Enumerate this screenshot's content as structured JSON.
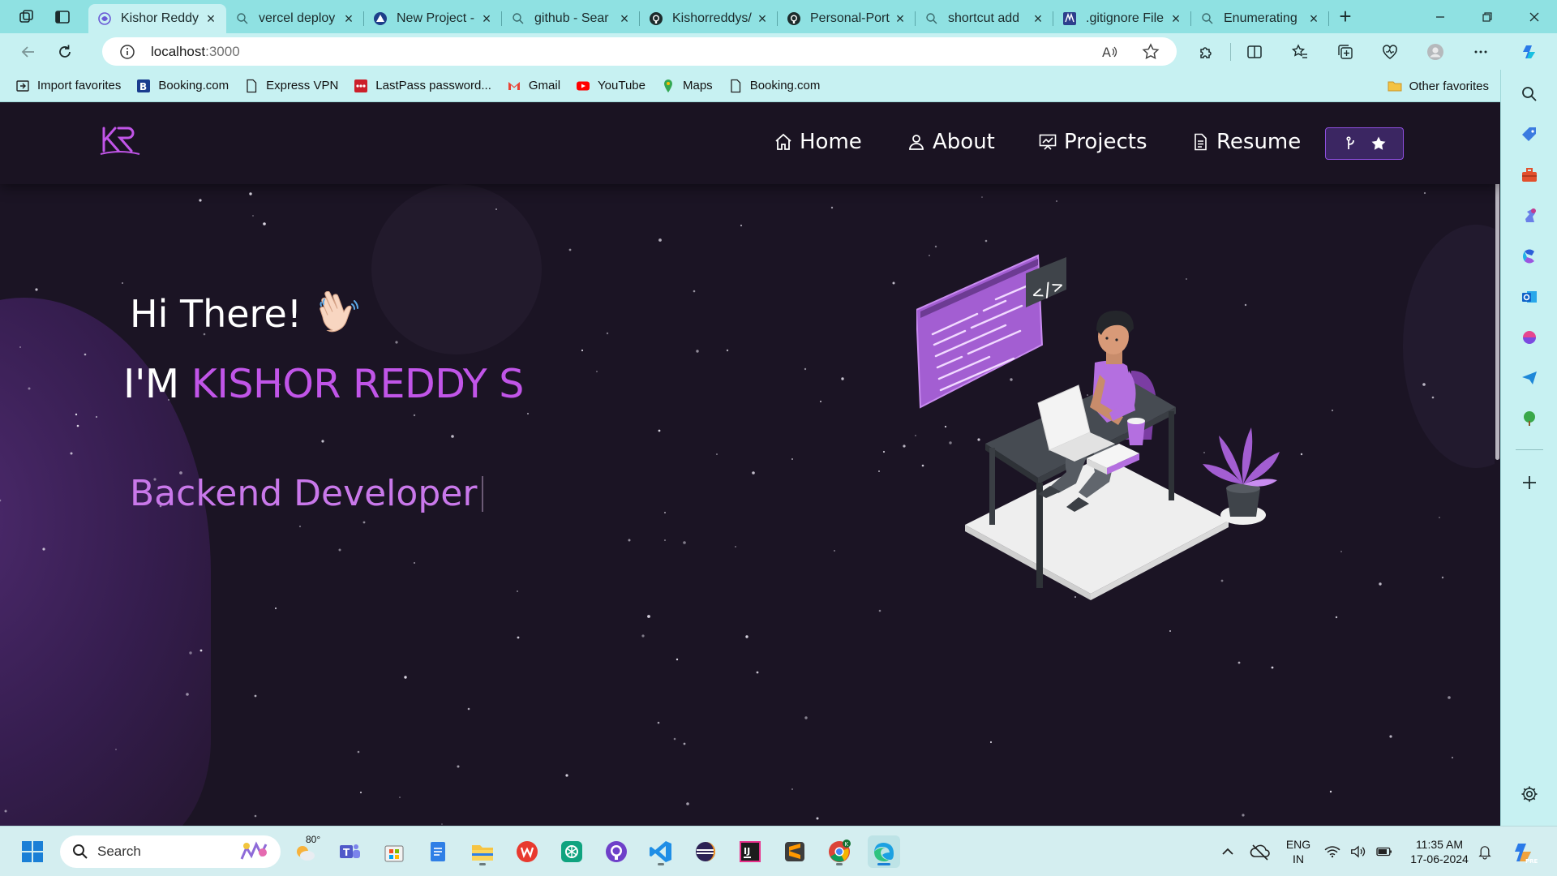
{
  "browser": {
    "tabs": [
      {
        "label": "Kishor Reddy",
        "favicon": "portfolio-icon",
        "active": true
      },
      {
        "label": "vercel deploy",
        "favicon": "search-icon"
      },
      {
        "label": "New Project -",
        "favicon": "vercel-icon"
      },
      {
        "label": "github - Sear",
        "favicon": "search-icon"
      },
      {
        "label": "Kishorreddys/",
        "favicon": "github-icon"
      },
      {
        "label": "Personal-Port",
        "favicon": "github-icon"
      },
      {
        "label": "shortcut add",
        "favicon": "search-icon"
      },
      {
        "label": ".gitignore File",
        "favicon": "gitignore-icon"
      },
      {
        "label": "Enumerating",
        "favicon": "search-icon"
      }
    ],
    "url": {
      "host": "localhost",
      "port": ":3000"
    },
    "favorites": [
      {
        "label": "Import favorites",
        "icon": "import-icon"
      },
      {
        "label": "Booking.com",
        "icon": "booking-icon"
      },
      {
        "label": "Express VPN",
        "icon": "page-icon"
      },
      {
        "label": "LastPass password...",
        "icon": "lastpass-icon"
      },
      {
        "label": "Gmail",
        "icon": "gmail-icon"
      },
      {
        "label": "YouTube",
        "icon": "youtube-icon"
      },
      {
        "label": "Maps",
        "icon": "maps-icon"
      },
      {
        "label": "Booking.com",
        "icon": "page-icon"
      }
    ],
    "other_favorites": "Other favorites"
  },
  "site": {
    "logo_text": "KR",
    "nav": [
      {
        "label": "Home",
        "icon": "home-icon"
      },
      {
        "label": "About",
        "icon": "user-icon"
      },
      {
        "label": "Projects",
        "icon": "projects-icon"
      },
      {
        "label": "Resume",
        "icon": "document-icon"
      }
    ],
    "hero": {
      "greeting": "Hi There!",
      "im_prefix": "I'M ",
      "name": "KISHOR REDDY S",
      "role": "Backend Developer"
    },
    "colors": {
      "accent": "#c155e8",
      "background": "#1b1424",
      "button": "#3b2662"
    }
  },
  "taskbar": {
    "search_label": "Search",
    "weather": "80°",
    "language": {
      "line1": "ENG",
      "line2": "IN"
    },
    "time": "11:35 AM",
    "date": "17-06-2024"
  }
}
